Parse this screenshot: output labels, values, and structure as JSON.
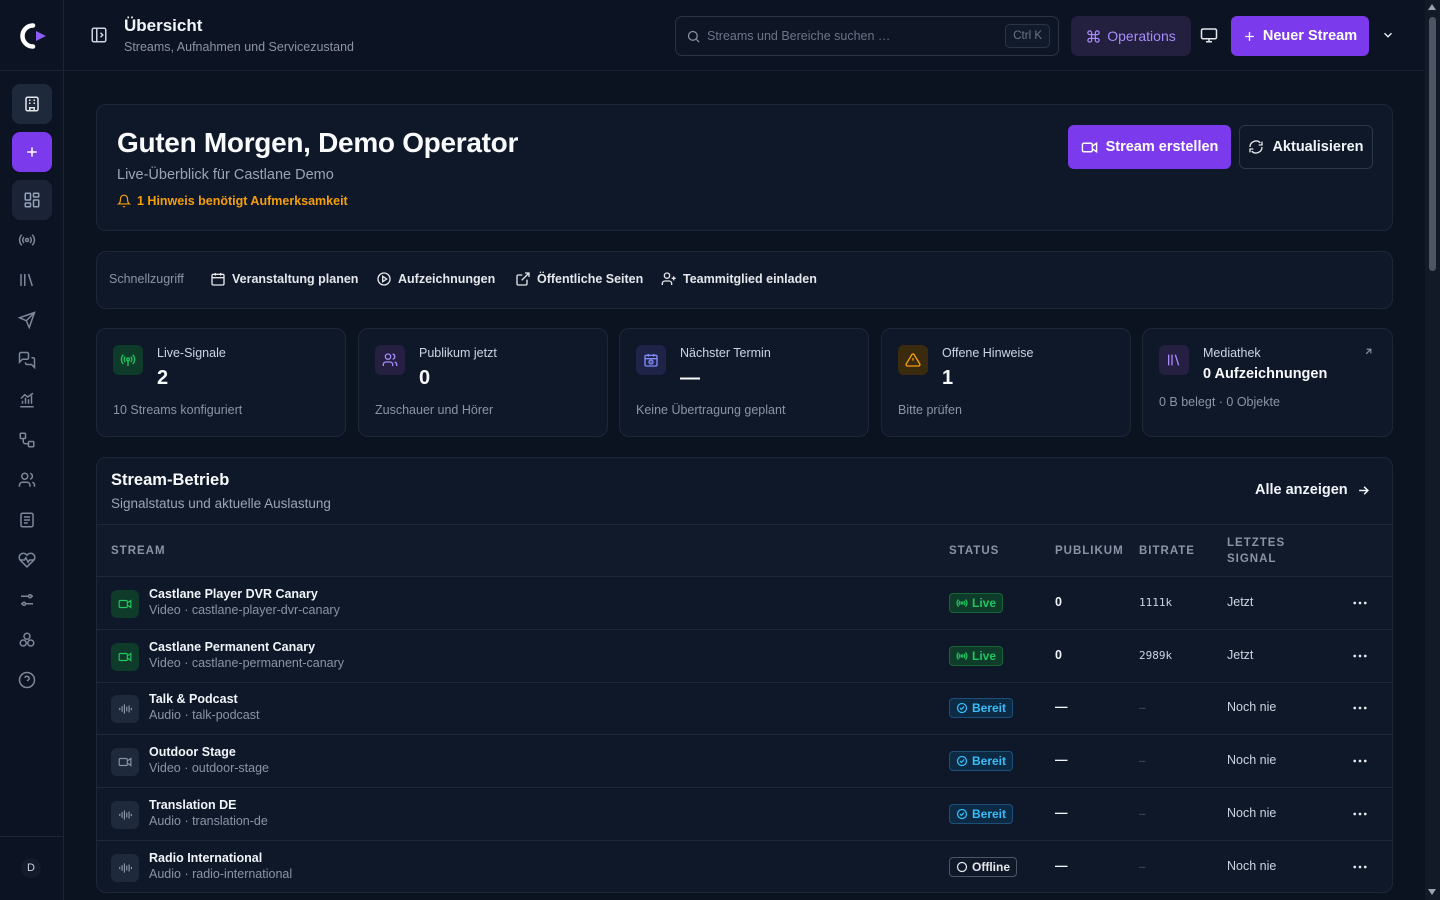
{
  "topbar": {
    "title": "Übersicht",
    "subtitle": "Streams, Aufnahmen und Servicezustand",
    "search_placeholder": "Streams und Bereiche suchen …",
    "search_shortcut": "Ctrl K",
    "operations_label": "Operations",
    "new_stream_label": "Neuer Stream"
  },
  "sidebar": {
    "avatar_initial": "D",
    "items": [
      "workspace-icon",
      "add-icon",
      "dashboard-icon",
      "broadcast-icon",
      "library-icon",
      "send-icon",
      "chat-icon",
      "analytics-icon",
      "workflow-icon",
      "users-icon",
      "document-icon",
      "health-icon",
      "settings-sliders-icon",
      "integrations-icon",
      "help-icon"
    ]
  },
  "hero": {
    "greeting": "Guten Morgen, Demo Operator",
    "subtitle": "Live-Überblick für Castlane Demo",
    "alert": "1 Hinweis benötigt Aufmerksamkeit",
    "create_label": "Stream erstellen",
    "refresh_label": "Aktualisieren"
  },
  "quick": {
    "label": "Schnellzugriff",
    "items": [
      {
        "label": "Veranstaltung planen",
        "icon": "calendar-icon"
      },
      {
        "label": "Aufzeichnungen",
        "icon": "play-circle-icon"
      },
      {
        "label": "Öffentliche Seiten",
        "icon": "external-link-icon"
      },
      {
        "label": "Teammitglied einladen",
        "icon": "user-plus-icon"
      }
    ]
  },
  "stats": [
    {
      "label": "Live-Signale",
      "value": "2",
      "foot": "10 Streams konfiguriert",
      "icon": "broadcast-icon",
      "color": "#22c55e"
    },
    {
      "label": "Publikum jetzt",
      "value": "0",
      "foot": "Zuschauer und Hörer",
      "icon": "users-icon",
      "color": "#a78bfa"
    },
    {
      "label": "Nächster Termin",
      "value": "—",
      "foot": "Keine Übertragung geplant",
      "icon": "calendar-clock-icon",
      "color": "#818cf8"
    },
    {
      "label": "Offene Hinweise",
      "value": "1",
      "foot": "Bitte prüfen",
      "icon": "warning-icon",
      "color": "#f59e0b"
    },
    {
      "label": "Mediathek",
      "value": "0 Aufzeichnungen",
      "foot": "0 B belegt · 0 Objekte",
      "icon": "library-icon",
      "color": "#a78bfa"
    }
  ],
  "streams": {
    "title": "Stream-Betrieb",
    "subtitle": "Signalstatus und aktuelle Auslastung",
    "all_label": "Alle anzeigen",
    "columns": [
      "STREAM",
      "STATUS",
      "PUBLIKUM",
      "BITRATE",
      "LETZTES",
      "SIGNAL"
    ],
    "rows": [
      {
        "name": "Castlane Player DVR Canary",
        "meta": "Video · castlane-player-dvr-canary",
        "kind": "video",
        "status": "Live",
        "status_type": "live",
        "audience": "0",
        "bitrate": "1111k",
        "last_signal": "Jetzt"
      },
      {
        "name": "Castlane Permanent Canary",
        "meta": "Video · castlane-permanent-canary",
        "kind": "video",
        "status": "Live",
        "status_type": "live",
        "audience": "0",
        "bitrate": "2989k",
        "last_signal": "Jetzt"
      },
      {
        "name": "Talk & Podcast",
        "meta": "Audio · talk-podcast",
        "kind": "audio",
        "status": "Bereit",
        "status_type": "ready",
        "audience": "—",
        "bitrate": "–",
        "last_signal": "Noch nie"
      },
      {
        "name": "Outdoor Stage",
        "meta": "Video · outdoor-stage",
        "kind": "video-idle",
        "status": "Bereit",
        "status_type": "ready",
        "audience": "—",
        "bitrate": "–",
        "last_signal": "Noch nie"
      },
      {
        "name": "Translation DE",
        "meta": "Audio · translation-de",
        "kind": "audio",
        "status": "Bereit",
        "status_type": "ready",
        "audience": "—",
        "bitrate": "–",
        "last_signal": "Noch nie"
      },
      {
        "name": "Radio International",
        "meta": "Audio · radio-international",
        "kind": "audio",
        "status": "Offline",
        "status_type": "off",
        "audience": "—",
        "bitrate": "–",
        "last_signal": "Noch nie"
      }
    ]
  },
  "colors": {
    "accent": "#7c3aed",
    "live": "#22c55e",
    "ready": "#38bdf8",
    "warning": "#f59e0b"
  }
}
